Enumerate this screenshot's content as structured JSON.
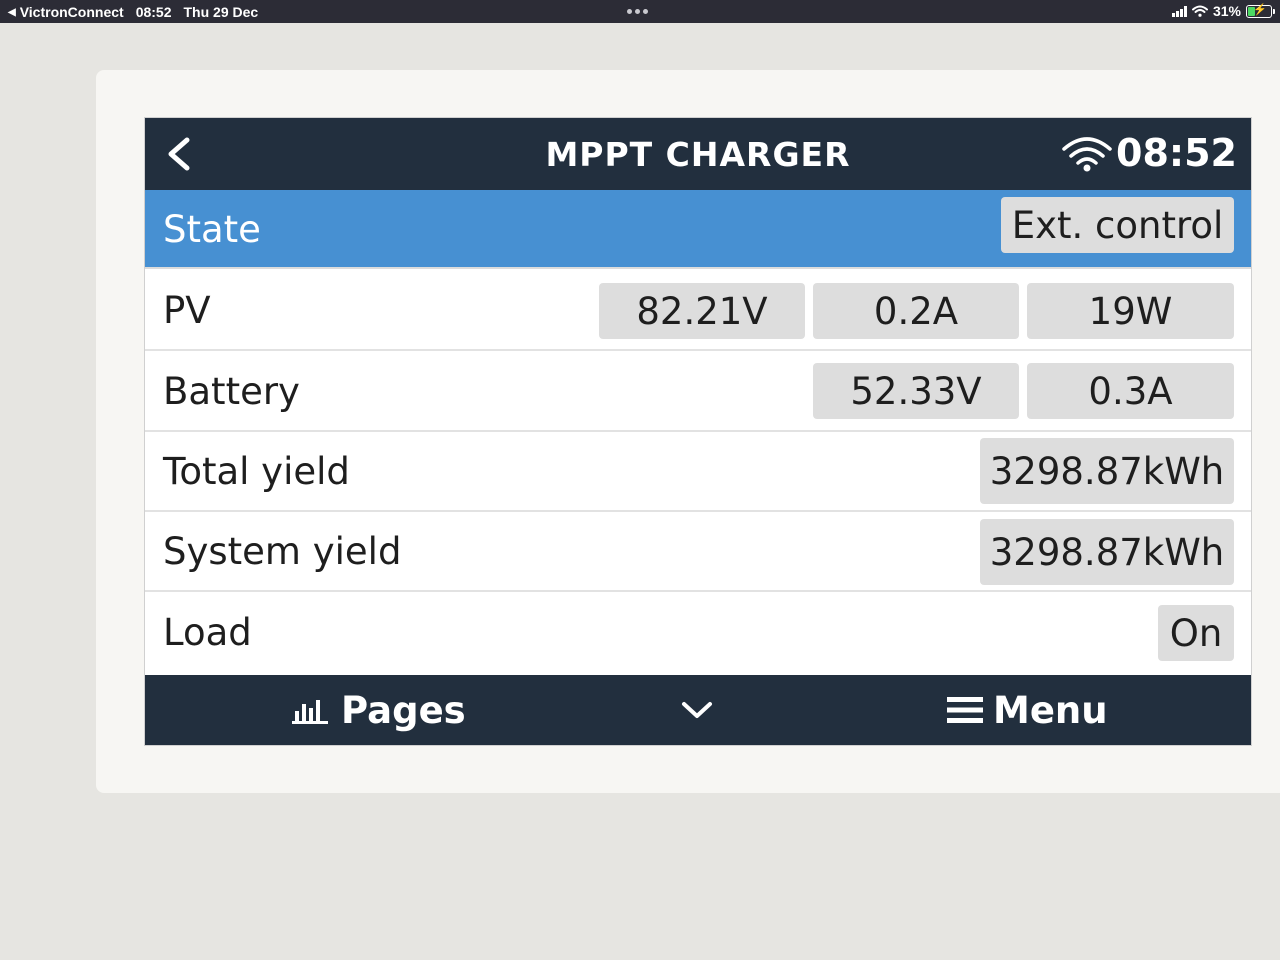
{
  "status_bar": {
    "app_name": "VictronConnect",
    "time": "08:52",
    "date": "Thu 29 Dec",
    "battery_percent": "31%",
    "icons": [
      "back-triangle-icon",
      "cellular-signal-icon",
      "wifi-icon",
      "battery-charging-icon"
    ]
  },
  "header": {
    "title": "MPPT CHARGER",
    "time": "08:52",
    "icons": [
      "back-chevron-icon",
      "wifi-icon"
    ]
  },
  "rows": {
    "state": {
      "label": "State",
      "value": "Ext. control"
    },
    "pv": {
      "label": "PV",
      "voltage": "82.21V",
      "current": "0.2A",
      "power": "19W"
    },
    "battery": {
      "label": "Battery",
      "voltage": "52.33V",
      "current": "0.3A"
    },
    "total_yield": {
      "label": "Total yield",
      "value": "3298.87kWh"
    },
    "system_yield": {
      "label": "System yield",
      "value": "3298.87kWh"
    },
    "load": {
      "label": "Load",
      "value": "On"
    }
  },
  "footer": {
    "pages_label": "Pages",
    "menu_label": "Menu",
    "icons": [
      "bar-chart-icon",
      "chevron-down-icon",
      "hamburger-menu-icon"
    ]
  },
  "colors": {
    "header_bg": "#222f3e",
    "selected_row_bg": "#4790d2",
    "value_box_bg": "#dddddd",
    "status_bar_bg": "#2c2c36"
  }
}
